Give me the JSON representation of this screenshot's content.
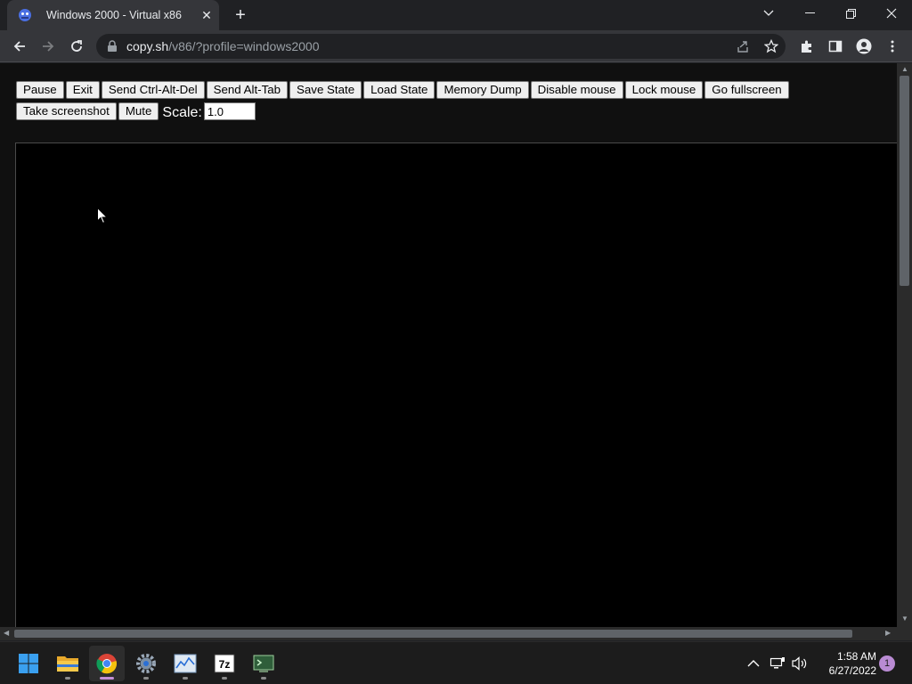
{
  "browser": {
    "tab": {
      "title": "Windows 2000 - Virtual x86",
      "favicon": "v86-favicon-icon"
    },
    "url": {
      "host": "copy.sh",
      "path": "/v86/?profile=windows2000"
    }
  },
  "emulator": {
    "buttons": [
      "Pause",
      "Exit",
      "Send Ctrl-Alt-Del",
      "Send Alt-Tab",
      "Save State",
      "Load State",
      "Memory Dump",
      "Disable mouse",
      "Lock mouse",
      "Go fullscreen",
      "Take screenshot",
      "Mute"
    ],
    "scale_label": "Scale:",
    "scale_value": "1.0"
  },
  "taskbar": {
    "apps": [
      "windows-start-icon",
      "file-explorer-icon",
      "chrome-icon",
      "settings-icon",
      "performance-monitor-icon",
      "7zip-icon",
      "terminal-icon"
    ],
    "clock_time": "1:58 AM",
    "clock_date": "6/27/2022",
    "notification_count": "1"
  },
  "colors": {
    "accent": "#c48fd6",
    "page_bg": "#101010",
    "screen_bg": "#000000"
  }
}
